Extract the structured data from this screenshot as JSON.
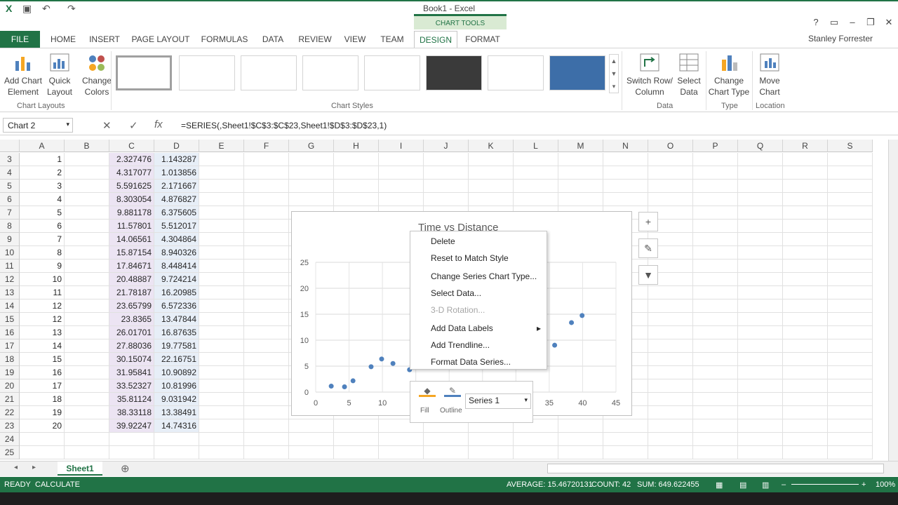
{
  "window": {
    "title": "Book1 - Excel",
    "chart_tools": "CHART TOOLS"
  },
  "tabs": [
    "FILE",
    "HOME",
    "INSERT",
    "PAGE LAYOUT",
    "FORMULAS",
    "DATA",
    "REVIEW",
    "VIEW",
    "TEAM",
    "DESIGN",
    "FORMAT"
  ],
  "user": "Stanley Forrester",
  "ribbon": {
    "add_chart_element": "Add Chart Element",
    "quick_layout": "Quick Layout",
    "change_colors": "Change Colors",
    "chart_layouts": "Chart Layouts",
    "chart_styles": "Chart Styles",
    "switch_row_col": "Switch Row/ Column",
    "select_data": "Select Data",
    "data_group": "Data",
    "change_chart_type": "Change Chart Type",
    "type_group": "Type",
    "move_chart": "Move Chart",
    "location_group": "Location"
  },
  "formula_bar": {
    "name_box": "Chart 2",
    "formula": "=SERIES(,Sheet1!$C$3:$C$23,Sheet1!$D$3:$D$23,1)"
  },
  "columns": [
    "A",
    "B",
    "C",
    "D",
    "E",
    "F",
    "G",
    "H",
    "I",
    "J",
    "K",
    "L",
    "M",
    "N",
    "O",
    "P",
    "Q",
    "R",
    "S"
  ],
  "rows": [
    {
      "r": "3",
      "a": "1",
      "c": "2.327476",
      "d": "1.143287"
    },
    {
      "r": "4",
      "a": "2",
      "c": "4.317077",
      "d": "1.013856"
    },
    {
      "r": "5",
      "a": "3",
      "c": "5.591625",
      "d": "2.171667"
    },
    {
      "r": "6",
      "a": "4",
      "c": "8.303054",
      "d": "4.876827"
    },
    {
      "r": "7",
      "a": "5",
      "c": "9.881178",
      "d": "6.375605"
    },
    {
      "r": "8",
      "a": "6",
      "c": "11.57801",
      "d": "5.512017"
    },
    {
      "r": "9",
      "a": "7",
      "c": "14.06561",
      "d": "4.304864"
    },
    {
      "r": "10",
      "a": "8",
      "c": "15.87154",
      "d": "8.940326"
    },
    {
      "r": "11",
      "a": "9",
      "c": "17.84671",
      "d": "8.448414"
    },
    {
      "r": "12",
      "a": "10",
      "c": "20.48887",
      "d": "9.724214"
    },
    {
      "r": "13",
      "a": "11",
      "c": "21.78187",
      "d": "16.20985"
    },
    {
      "r": "14",
      "a": "12",
      "c": "23.65799",
      "d": "6.572336"
    },
    {
      "r": "15",
      "a": "12",
      "c": "23.8365",
      "d": "13.47844"
    },
    {
      "r": "16",
      "a": "13",
      "c": "26.01701",
      "d": "16.87635"
    },
    {
      "r": "17",
      "a": "14",
      "c": "27.88036",
      "d": "19.77581"
    },
    {
      "r": "18",
      "a": "15",
      "c": "30.15074",
      "d": "22.16751"
    },
    {
      "r": "19",
      "a": "16",
      "c": "31.95841",
      "d": "10.90892"
    },
    {
      "r": "20",
      "a": "17",
      "c": "33.52327",
      "d": "10.81996"
    },
    {
      "r": "21",
      "a": "18",
      "c": "35.81124",
      "d": "9.031942"
    },
    {
      "r": "22",
      "a": "19",
      "c": "38.33118",
      "d": "13.38491"
    },
    {
      "r": "23",
      "a": "20",
      "c": "39.92247",
      "d": "14.74316"
    },
    {
      "r": "24",
      "a": "",
      "c": "",
      "d": ""
    },
    {
      "r": "25",
      "a": "",
      "c": "",
      "d": ""
    }
  ],
  "chart": {
    "title": "Time vs Distance",
    "yticks": [
      "25",
      "20",
      "15",
      "10",
      "5",
      "0"
    ],
    "xticks": [
      "0",
      "5",
      "10",
      "35",
      "40",
      "45"
    ]
  },
  "chart_data": {
    "type": "scatter",
    "title": "Time vs Distance",
    "xlim": [
      0,
      45
    ],
    "ylim": [
      0,
      25
    ],
    "x": [
      2.327476,
      4.317077,
      5.591625,
      8.303054,
      9.881178,
      11.57801,
      14.06561,
      15.87154,
      17.84671,
      20.48887,
      21.78187,
      23.65799,
      23.8365,
      26.01701,
      27.88036,
      30.15074,
      31.95841,
      33.52327,
      35.81124,
      38.33118,
      39.92247
    ],
    "y": [
      1.143287,
      1.013856,
      2.171667,
      4.876827,
      6.375605,
      5.512017,
      4.304864,
      8.940326,
      8.448414,
      9.724214,
      16.20985,
      6.572336,
      13.47844,
      16.87635,
      19.77581,
      22.16751,
      10.90892,
      10.81996,
      9.031942,
      13.38491,
      14.74316
    ]
  },
  "context_menu": [
    {
      "label": "Delete",
      "disabled": false
    },
    {
      "label": "Reset to Match Style",
      "disabled": false
    },
    {
      "label": "Change Series Chart Type...",
      "disabled": false
    },
    {
      "label": "Select Data...",
      "disabled": false
    },
    {
      "label": "3-D Rotation...",
      "disabled": true
    },
    {
      "label": "Add Data Labels",
      "disabled": false
    },
    {
      "label": "Add Trendline...",
      "disabled": false
    },
    {
      "label": "Format Data Series...",
      "disabled": false
    }
  ],
  "mini_toolbar": {
    "fill": "Fill",
    "outline": "Outline",
    "series": "Series 1"
  },
  "sheet": {
    "tab": "Sheet1"
  },
  "status": {
    "ready": "READY",
    "calculate": "CALCULATE",
    "average": "AVERAGE: 15.46720131",
    "count": "COUNT: 42",
    "sum": "SUM: 649.622455",
    "zoom": "100%"
  }
}
